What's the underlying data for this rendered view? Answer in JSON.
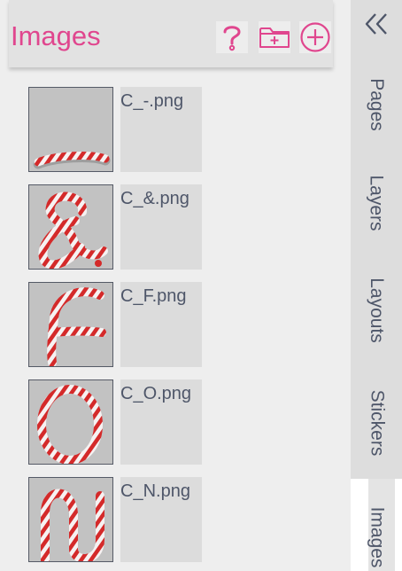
{
  "panel": {
    "title": "Images",
    "help_icon": "question-mark-icon",
    "new_folder_icon": "folder-plus-icon",
    "add_icon": "plus-circle-icon"
  },
  "images": [
    {
      "filename": "C_-.png",
      "glyph": "-"
    },
    {
      "filename": "C_&.png",
      "glyph": "&"
    },
    {
      "filename": "C_F.png",
      "glyph": "F"
    },
    {
      "filename": "C_O.png",
      "glyph": "O"
    },
    {
      "filename": "C_N.png",
      "glyph": "N"
    }
  ],
  "sidebar": {
    "collapse_icon": "double-chevron-left-icon",
    "tabs": [
      {
        "label": "Pages"
      },
      {
        "label": "Layers"
      },
      {
        "label": "Layouts"
      },
      {
        "label": "Stickers"
      },
      {
        "label": "Images",
        "active": true
      }
    ]
  },
  "colors": {
    "accent": "#e0468e",
    "text": "#4e5669",
    "candy_red": "#d42a2a"
  }
}
